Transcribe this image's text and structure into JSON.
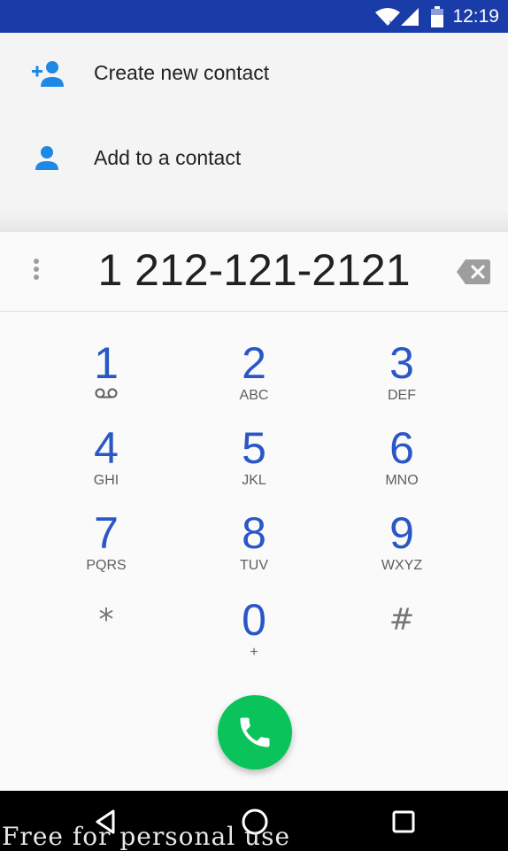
{
  "status_bar": {
    "time": "12:19",
    "icons": [
      "wifi-icon",
      "signal-icon",
      "battery-icon"
    ]
  },
  "suggestions": [
    {
      "label": "Create new contact",
      "icon": "add-person-icon"
    },
    {
      "label": "Add to a contact",
      "icon": "person-icon"
    }
  ],
  "dialer": {
    "number": "1 212-121-2121",
    "keys": [
      {
        "digit": "1",
        "letters": "",
        "extra_icon": "voicemail-icon"
      },
      {
        "digit": "2",
        "letters": "ABC"
      },
      {
        "digit": "3",
        "letters": "DEF"
      },
      {
        "digit": "4",
        "letters": "GHI"
      },
      {
        "digit": "5",
        "letters": "JKL"
      },
      {
        "digit": "6",
        "letters": "MNO"
      },
      {
        "digit": "7",
        "letters": "PQRS"
      },
      {
        "digit": "8",
        "letters": "TUV"
      },
      {
        "digit": "9",
        "letters": "WXYZ"
      },
      {
        "digit": "*",
        "letters": ""
      },
      {
        "digit": "0",
        "letters": "+"
      },
      {
        "digit": "#",
        "letters": ""
      }
    ]
  },
  "watermark": "Free for personal use",
  "colors": {
    "status_bar": "#1a3ca8",
    "accent": "#2a56c6",
    "call": "#0ac45b",
    "contact_icon": "#1e88e5"
  }
}
